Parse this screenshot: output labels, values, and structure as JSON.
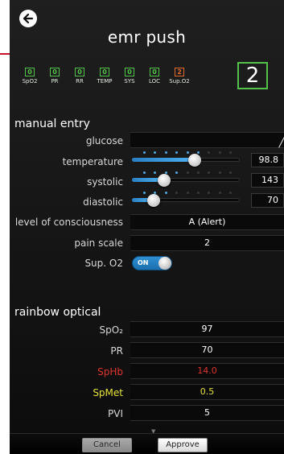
{
  "header": {
    "title": "emr push",
    "parameters": [
      {
        "label": "SpO2",
        "value": "0",
        "color": "#54c24a"
      },
      {
        "label": "PR",
        "value": "0",
        "color": "#54c24a"
      },
      {
        "label": "RR",
        "value": "0",
        "color": "#54c24a"
      },
      {
        "label": "TEMP",
        "value": "0",
        "color": "#54c24a"
      },
      {
        "label": "SYS",
        "value": "0",
        "color": "#54c24a"
      },
      {
        "label": "LOC",
        "value": "0",
        "color": "#54c24a"
      },
      {
        "label": "Sup.O2",
        "value": "2",
        "color": "#e06b2a"
      }
    ],
    "total_score": "2"
  },
  "manual_entry": {
    "title": "manual entry",
    "glucose": {
      "label": "glucose",
      "value": ""
    },
    "temperature": {
      "label": "temperature",
      "value": "98.8",
      "fill": 0.58
    },
    "systolic": {
      "label": "systolic",
      "value": "143",
      "fill": 0.3
    },
    "diastolic": {
      "label": "diastolic",
      "value": "70",
      "fill": 0.2
    },
    "loc": {
      "label": "level of consciousness",
      "value": "A (Alert)"
    },
    "pain": {
      "label": "pain scale",
      "value": "2"
    },
    "sup_o2": {
      "label": "Sup. O2",
      "toggle": "ON"
    }
  },
  "rainbow_optical": {
    "title": "rainbow optical",
    "rows": [
      {
        "label": "SpO₂",
        "value": "97",
        "color": "#ffffff"
      },
      {
        "label": "PR",
        "value": "70",
        "color": "#ffffff"
      },
      {
        "label": "SpHb",
        "value": "14.0",
        "color": "#e0342c"
      },
      {
        "label": "SpMet",
        "value": "0.5",
        "color": "#e6e23a"
      },
      {
        "label": "PVI",
        "value": "5",
        "color": "#ffffff"
      }
    ]
  },
  "footer": {
    "cancel": "Cancel",
    "approve": "Approve"
  }
}
